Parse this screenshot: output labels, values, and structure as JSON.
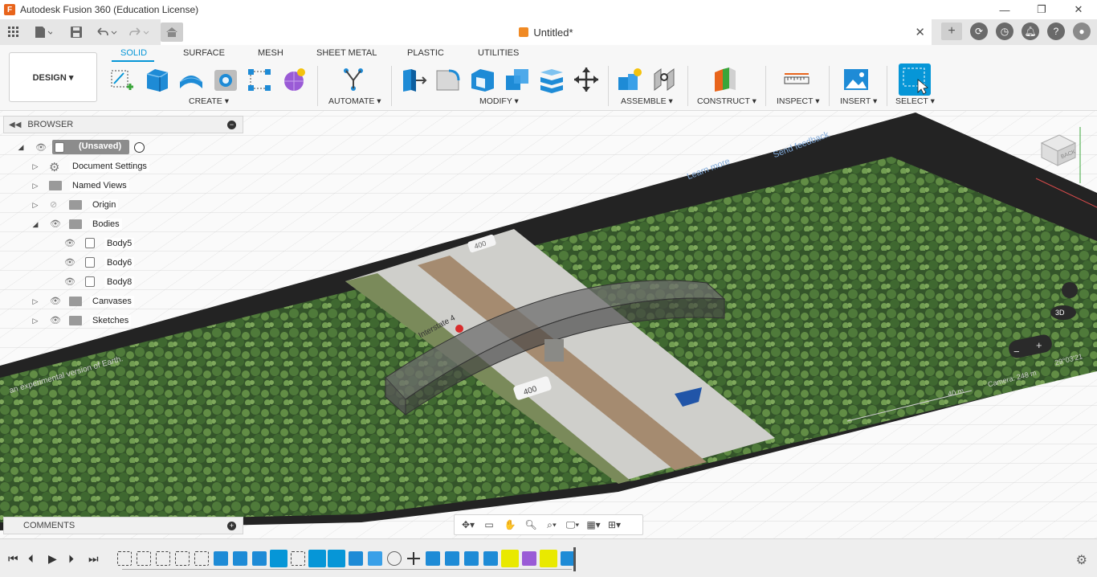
{
  "window": {
    "title": "Autodesk Fusion 360 (Education License)",
    "app_icon": "F",
    "controls": [
      "—",
      "❐",
      "✕"
    ]
  },
  "quick_access": {
    "grid_icon": "app-grid-icon",
    "file_icon": "file-icon",
    "save_icon": "save-icon",
    "undo_icon": "undo-icon",
    "redo_icon": "redo-icon"
  },
  "document": {
    "tab_name": "Untitled*",
    "close": "✕"
  },
  "ribbon": {
    "workspace": "DESIGN ▾",
    "tabs": [
      "SOLID",
      "SURFACE",
      "MESH",
      "SHEET METAL",
      "PLASTIC",
      "UTILITIES"
    ],
    "active_tab": "SOLID",
    "groups": [
      {
        "label": "CREATE ▾"
      },
      {
        "label": "AUTOMATE ▾"
      },
      {
        "label": "MODIFY ▾"
      },
      {
        "label": "ASSEMBLE ▾"
      },
      {
        "label": "CONSTRUCT ▾"
      },
      {
        "label": "INSPECT ▾"
      },
      {
        "label": "INSERT ▾"
      },
      {
        "label": "SELECT ▾"
      }
    ]
  },
  "browser": {
    "title": "BROWSER",
    "root": "(Unsaved)",
    "items": [
      {
        "label": "Document Settings"
      },
      {
        "label": "Named Views"
      },
      {
        "label": "Origin"
      },
      {
        "label": "Bodies"
      },
      {
        "label": "Body5"
      },
      {
        "label": "Body6"
      },
      {
        "label": "Body8"
      },
      {
        "label": "Canvases"
      },
      {
        "label": "Sketches"
      }
    ]
  },
  "canvas_overlay": {
    "learn_more": "Learn more",
    "send_feedback": "Send feedback",
    "experimental": "an experimental version of Earth.",
    "road_label": "Interstate 4",
    "shield_400_a": "400",
    "shield_400_b": "400",
    "camera": "Camera: 248 m",
    "coords": "29°03'21",
    "scale": "40 m",
    "view_3d": "3D"
  },
  "comments": {
    "title": "COMMENTS"
  },
  "colors": {
    "accent": "#0696d7",
    "trees": "#3d5f2e",
    "road": "#c9c9c6"
  }
}
